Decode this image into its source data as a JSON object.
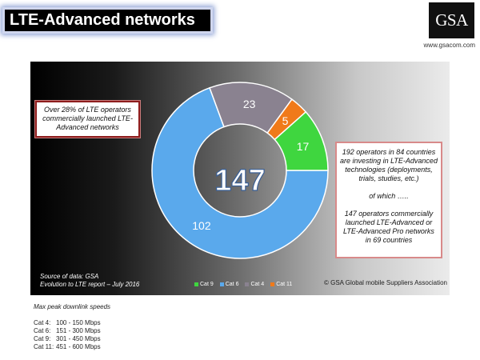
{
  "header": {
    "title": "LTE-Advanced networks",
    "logo_text": "GSA",
    "website": "www.gsacom.com"
  },
  "chart_data": {
    "type": "pie",
    "variant": "donut",
    "center_label": "147",
    "categories": [
      "Cat 6",
      "Cat 4",
      "Cat 11",
      "Cat 9"
    ],
    "values": [
      102,
      23,
      5,
      17
    ],
    "colors": [
      "#5aa9ec",
      "#8a8290",
      "#f07a1a",
      "#3fd63f"
    ],
    "legend": [
      "Cat 9",
      "Cat 6",
      "Cat 4",
      "Cat 11"
    ],
    "legend_colors": [
      "#3fd63f",
      "#5aa9ec",
      "#8a8290",
      "#f07a1a"
    ],
    "legend_position": "bottom"
  },
  "callouts": {
    "left": "Over 28% of LTE operators commercially launched LTE-Advanced networks",
    "right_1": "192 operators in 84 countries are investing in LTE-Advanced technologies (deployments, trials, studies, etc.)",
    "right_2": "of which …..",
    "right_3": "147 operators commercially launched LTE-Advanced or LTE-Advanced Pro networks in 69 countries"
  },
  "source": {
    "line1": "Source of data: GSA",
    "line2": "Evolution to LTE report – July 2016"
  },
  "copyright": "© GSA Global mobile Suppliers Association",
  "notes": {
    "title": "Max peak downlink speeds",
    "speeds": [
      {
        "cat": "Cat 4:",
        "range": "100 - 150 Mbps"
      },
      {
        "cat": "Cat 6:",
        "range": "151 - 300 Mbps"
      },
      {
        "cat": "Cat 9:",
        "range": "301 - 450 Mbps"
      },
      {
        "cat": "Cat 11:",
        "range": "451 - 600 Mbps"
      }
    ]
  }
}
